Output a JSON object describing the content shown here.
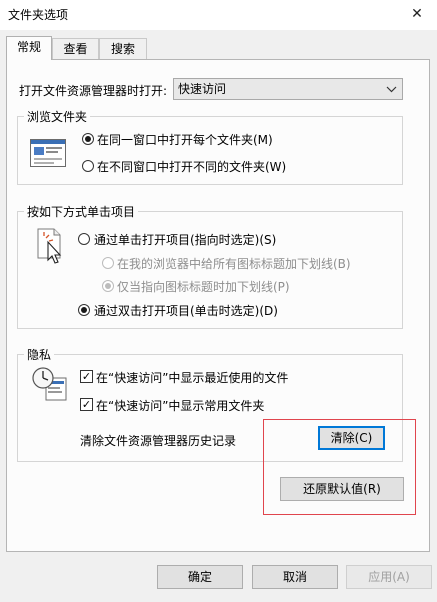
{
  "window": {
    "title": "文件夹选项",
    "close_glyph": "✕"
  },
  "tabs": [
    {
      "label": "常规",
      "active": true
    },
    {
      "label": "查看",
      "active": false
    },
    {
      "label": "搜索",
      "active": false
    }
  ],
  "open_with": {
    "label": "打开文件资源管理器时打开:",
    "value": "快速访问",
    "arrow_icon": "chevron-down-icon"
  },
  "browse_folders": {
    "legend": "浏览文件夹",
    "options": [
      {
        "label": "在同一窗口中打开每个文件夹(M)",
        "selected": true
      },
      {
        "label": "在不同窗口中打开不同的文件夹(W)",
        "selected": false
      }
    ]
  },
  "click_items": {
    "legend": "按如下方式单击项目",
    "single_click": {
      "label": "通过单击打开项目(指向时选定)(S)",
      "selected": false
    },
    "sub_options": [
      {
        "label": "在我的浏览器中给所有图标标题加下划线(B)",
        "selected": false,
        "enabled": false
      },
      {
        "label": "仅当指向图标标题时加下划线(P)",
        "selected": true,
        "enabled": false
      }
    ],
    "double_click": {
      "label": "通过双击打开项目(单击时选定)(D)",
      "selected": true
    }
  },
  "privacy": {
    "legend": "隐私",
    "checkboxes": [
      {
        "label": "在“快速访问”中显示最近使用的文件",
        "checked": true
      },
      {
        "label": "在“快速访问”中显示常用文件夹",
        "checked": true
      }
    ],
    "clear_label": "清除文件资源管理器历史记录",
    "clear_button": "清除(C)"
  },
  "restore_button": "还原默认值(R)",
  "footer": {
    "ok": "确定",
    "cancel": "取消",
    "apply": "应用(A)"
  },
  "check_glyph": "✓",
  "colors": {
    "annotation_box": "#e0454d",
    "focus_border": "#0078d7",
    "panel": "#fcfcfc",
    "window": "#f0f0f0"
  }
}
